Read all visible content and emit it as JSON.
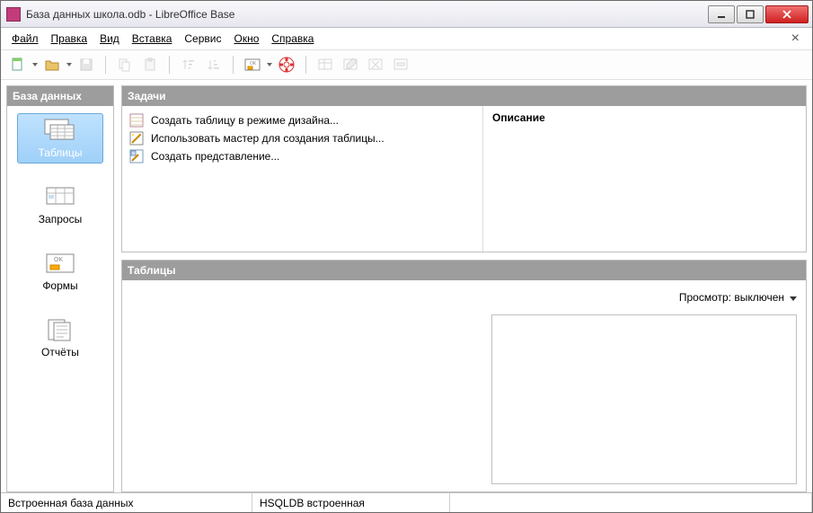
{
  "window": {
    "title": "База данных школа.odb - LibreOffice Base"
  },
  "menu": {
    "file": "Файл",
    "edit": "Правка",
    "view": "Вид",
    "insert": "Вставка",
    "service": "Сервис",
    "window": "Окно",
    "help": "Справка"
  },
  "sidebar": {
    "header": "База данных",
    "items": [
      {
        "label": "Таблицы"
      },
      {
        "label": "Запросы"
      },
      {
        "label": "Формы"
      },
      {
        "label": "Отчёты"
      }
    ]
  },
  "tasks": {
    "header": "Задачи",
    "items": [
      {
        "label": "Создать таблицу в режиме дизайна..."
      },
      {
        "label": "Использовать мастер для создания таблицы..."
      },
      {
        "label": "Создать представление..."
      }
    ],
    "description_header": "Описание"
  },
  "list": {
    "header": "Таблицы",
    "preview_label": "Просмотр: выключен"
  },
  "status": {
    "left": "Встроенная база данных",
    "mid": "HSQLDB встроенная"
  }
}
